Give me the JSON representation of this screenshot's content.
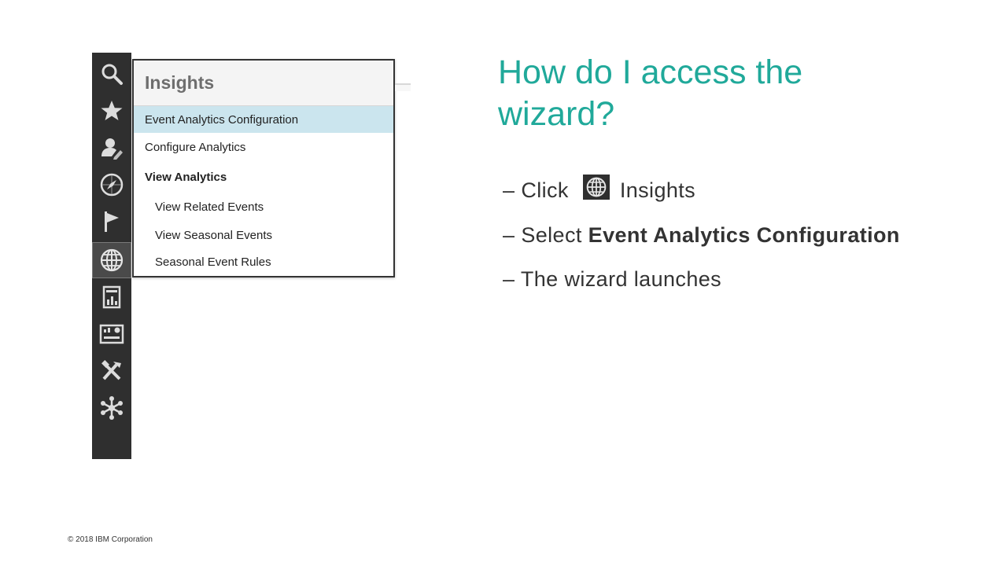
{
  "sidebar": {
    "items": [
      {
        "icon": "search-icon"
      },
      {
        "icon": "star-icon"
      },
      {
        "icon": "user-edit-icon"
      },
      {
        "icon": "compass-icon"
      },
      {
        "icon": "flag-icon"
      },
      {
        "icon": "globe-icon",
        "active": true
      },
      {
        "icon": "report-icon"
      },
      {
        "icon": "dashboard-icon"
      },
      {
        "icon": "tools-icon"
      },
      {
        "icon": "hub-icon"
      }
    ]
  },
  "insights_menu": {
    "title": "Insights",
    "items": [
      {
        "label": "Event Analytics Configuration",
        "selected": true
      },
      {
        "label": "Configure Analytics"
      },
      {
        "label": "View Analytics"
      },
      {
        "label": "View Related Events"
      },
      {
        "label": "View Seasonal Events"
      },
      {
        "label": "Seasonal Event Rules"
      }
    ]
  },
  "slide": {
    "title": "How do I access the wizard?",
    "bullets": {
      "b1_prefix": "– Click",
      "b1_suffix": "Insights",
      "b2_prefix": "– Select",
      "b2_bold": "Event Analytics Configuration",
      "b3": "– The wizard launches"
    }
  },
  "footer": "© 2018 IBM Corporation",
  "colors": {
    "accent": "#20a99a",
    "rail": "#2f2f2f",
    "selected": "#cbe5ee"
  }
}
